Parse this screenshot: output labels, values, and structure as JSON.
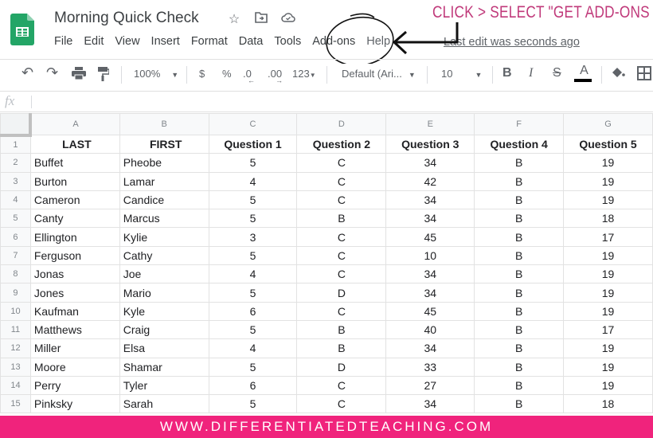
{
  "app": {
    "title": "Morning Quick Check",
    "logo_icon": "google-sheets-logo",
    "title_icons": [
      {
        "name": "star-icon",
        "glyph": "☆"
      },
      {
        "name": "move-to-folder-icon",
        "glyph": "⊡"
      },
      {
        "name": "cloud-saved-icon",
        "glyph": "☁"
      }
    ],
    "menu": [
      "File",
      "Edit",
      "View",
      "Insert",
      "Format",
      "Data",
      "Tools",
      "Add-ons",
      "Help"
    ],
    "last_edit": "Last edit was seconds ago"
  },
  "annotation": {
    "text": "CLICK > SELECT \"GET ADD-ONS",
    "color": "#c0397a",
    "target": "Add-ons"
  },
  "toolbar": {
    "undo": "↶",
    "redo": "↷",
    "print": "🖶",
    "paint_format": "⚒",
    "zoom": "100%",
    "currency": "$",
    "percent": "%",
    "decrease_decimal": ".0",
    "increase_decimal": ".00",
    "more_formats": "123",
    "font": "Default (Ari...",
    "font_size": "10",
    "bold": "B",
    "italic": "I",
    "strikethrough": "S",
    "text_color": "A",
    "fill_color": "◆",
    "borders": "⊞"
  },
  "formula_bar": {
    "fx_label": "fx",
    "value": ""
  },
  "sheet": {
    "columns": [
      "A",
      "B",
      "C",
      "D",
      "E",
      "F",
      "G"
    ],
    "header": [
      "LAST",
      "FIRST",
      "Question 1",
      "Question 2",
      "Question 3",
      "Question 4",
      "Question 5"
    ],
    "rows": [
      [
        "Buffet",
        "Pheobe",
        "5",
        "C",
        "34",
        "B",
        "19"
      ],
      [
        "Burton",
        "Lamar",
        "4",
        "C",
        "42",
        "B",
        "19"
      ],
      [
        "Cameron",
        "Candice",
        "5",
        "C",
        "34",
        "B",
        "19"
      ],
      [
        "Canty",
        "Marcus",
        "5",
        "B",
        "34",
        "B",
        "18"
      ],
      [
        "Ellington",
        "Kylie",
        "3",
        "C",
        "45",
        "B",
        "17"
      ],
      [
        "Ferguson",
        "Cathy",
        "5",
        "C",
        "10",
        "B",
        "19"
      ],
      [
        "Jonas",
        "Joe",
        "4",
        "C",
        "34",
        "B",
        "19"
      ],
      [
        "Jones",
        "Mario",
        "5",
        "D",
        "34",
        "B",
        "19"
      ],
      [
        "Kaufman",
        "Kyle",
        "6",
        "C",
        "45",
        "B",
        "19"
      ],
      [
        "Matthews",
        "Craig",
        "5",
        "B",
        "40",
        "B",
        "17"
      ],
      [
        "Miller",
        "Elsa",
        "4",
        "B",
        "34",
        "B",
        "19"
      ],
      [
        "Moore",
        "Shamar",
        "5",
        "D",
        "33",
        "B",
        "19"
      ],
      [
        "Perry",
        "Tyler",
        "6",
        "C",
        "27",
        "B",
        "19"
      ],
      [
        "Pinksky",
        "Sarah",
        "5",
        "C",
        "34",
        "B",
        "18"
      ]
    ]
  },
  "banner": {
    "text": "WWW.DIFFERENTIATEDTEACHING.COM",
    "color": "#f0237c"
  }
}
